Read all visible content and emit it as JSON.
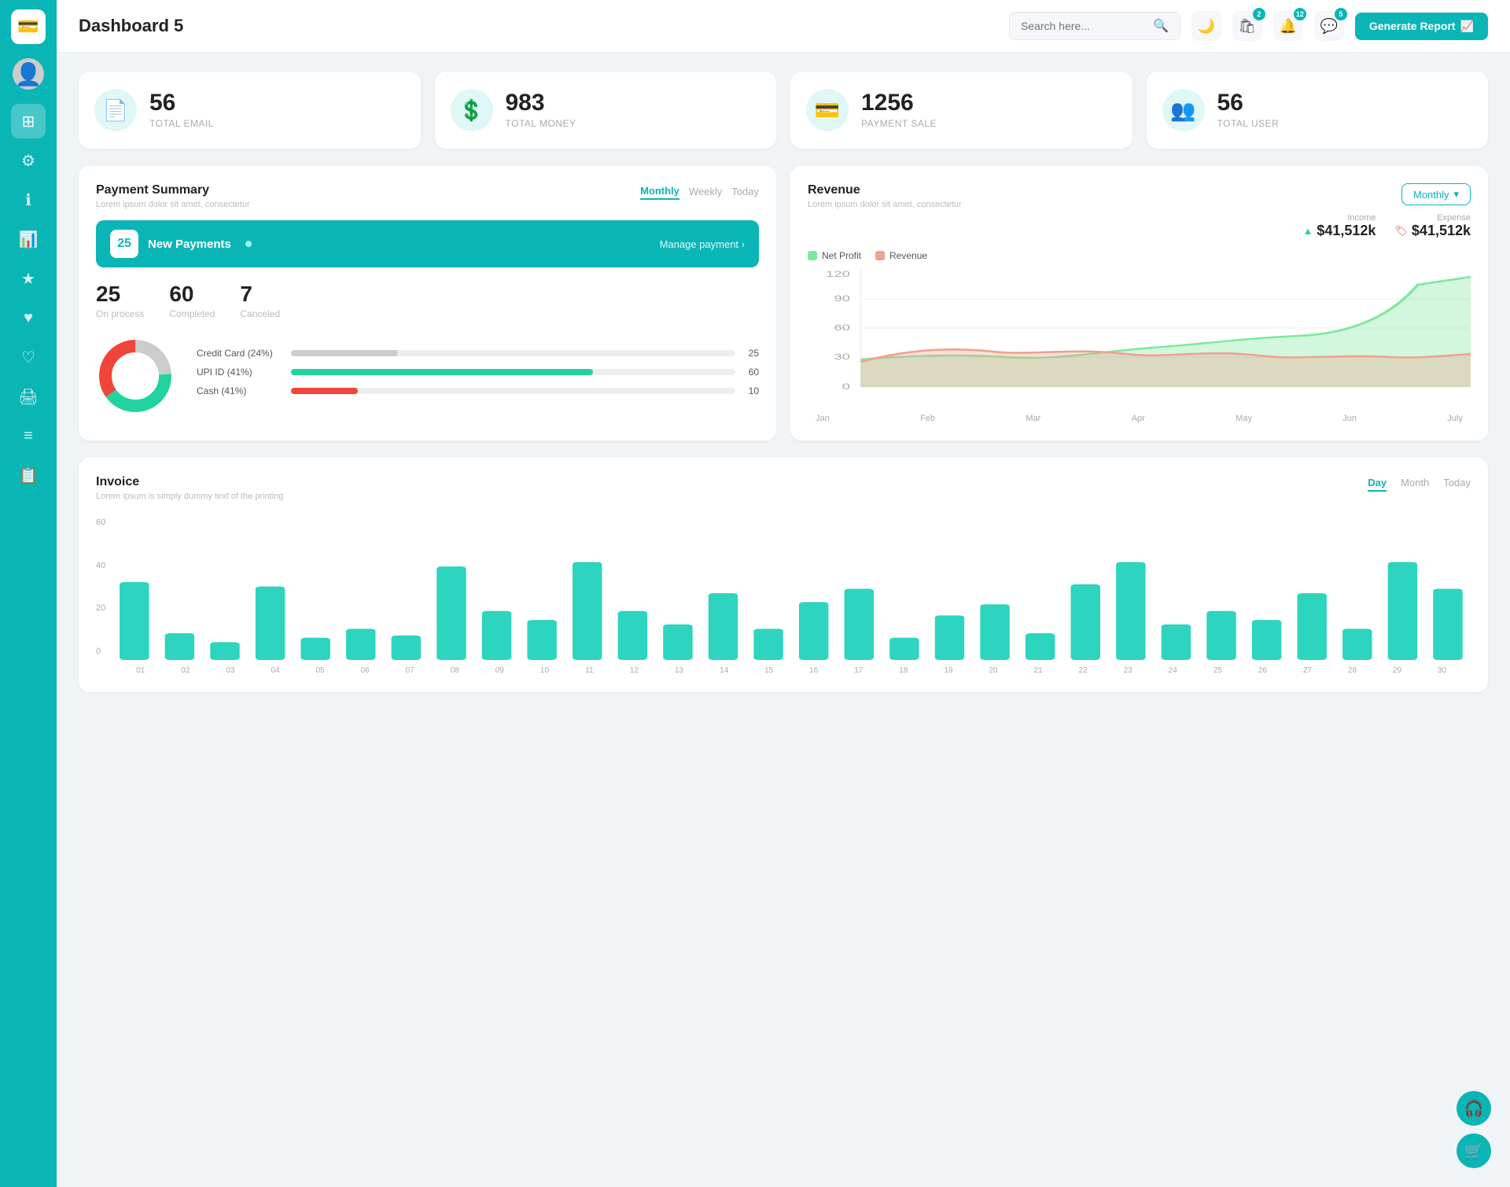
{
  "sidebar": {
    "logo_icon": "💳",
    "items": [
      {
        "id": "dashboard",
        "icon": "⊞",
        "active": true
      },
      {
        "id": "settings",
        "icon": "⚙"
      },
      {
        "id": "info",
        "icon": "ℹ"
      },
      {
        "id": "analytics",
        "icon": "📊"
      },
      {
        "id": "star",
        "icon": "★"
      },
      {
        "id": "heart1",
        "icon": "♥"
      },
      {
        "id": "heart2",
        "icon": "♡"
      },
      {
        "id": "print",
        "icon": "🖨"
      },
      {
        "id": "list",
        "icon": "≡"
      },
      {
        "id": "report",
        "icon": "📋"
      }
    ]
  },
  "header": {
    "title": "Dashboard 5",
    "search_placeholder": "Search here...",
    "generate_btn": "Generate Report",
    "icons": {
      "bag_badge": "2",
      "bell_badge": "12",
      "chat_badge": "5"
    }
  },
  "stat_cards": [
    {
      "id": "email",
      "icon": "📄",
      "value": "56",
      "label": "TOTAL EMAIL"
    },
    {
      "id": "money",
      "icon": "💲",
      "value": "983",
      "label": "TOTAL MONEY"
    },
    {
      "id": "payment",
      "icon": "💳",
      "value": "1256",
      "label": "PAYMENT SALE"
    },
    {
      "id": "user",
      "icon": "👥",
      "value": "56",
      "label": "TOTAL USER"
    }
  ],
  "payment_summary": {
    "title": "Payment Summary",
    "subtitle": "Lorem ipsum dolor sit amet, consectetur",
    "tabs": [
      "Monthly",
      "Weekly",
      "Today"
    ],
    "active_tab": "Monthly",
    "new_payments_count": "25",
    "new_payments_label": "New Payments",
    "manage_link": "Manage payment",
    "stats": [
      {
        "value": "25",
        "label": "On process"
      },
      {
        "value": "60",
        "label": "Completed"
      },
      {
        "value": "7",
        "label": "Canceled"
      }
    ],
    "methods": [
      {
        "label": "Credit Card (24%)",
        "percent": 24,
        "color": "#aaa",
        "count": "25"
      },
      {
        "label": "UPI ID (41%)",
        "percent": 41,
        "color": "#22d3a0",
        "count": "60"
      },
      {
        "label": "Cash (41%)",
        "percent": 10,
        "color": "#f0453a",
        "count": "10"
      }
    ],
    "donut": {
      "segments": [
        {
          "value": 24,
          "color": "#ddd"
        },
        {
          "value": 41,
          "color": "#22d3a0"
        },
        {
          "value": 35,
          "color": "#f0453a"
        }
      ]
    }
  },
  "revenue": {
    "title": "Revenue",
    "subtitle": "Lorem ipsum dolor sit amet, consectetur",
    "active_tab": "Monthly",
    "income_label": "Income",
    "income_value": "$41,512k",
    "expense_label": "Expense",
    "expense_value": "$41,512k",
    "legend": [
      {
        "label": "Net Profit",
        "color": "#7ee89a"
      },
      {
        "label": "Revenue",
        "color": "#f0a090"
      }
    ],
    "x_labels": [
      "Jan",
      "Feb",
      "Mar",
      "Apr",
      "May",
      "Jun",
      "July"
    ],
    "y_labels": [
      "0",
      "30",
      "60",
      "90",
      "120"
    ]
  },
  "invoice": {
    "title": "Invoice",
    "subtitle": "Lorem ipsum is simply dummy text of the printing",
    "tabs": [
      "Day",
      "Month",
      "Today"
    ],
    "active_tab": "Day",
    "y_labels": [
      "0",
      "20",
      "40",
      "60"
    ],
    "x_labels": [
      "01",
      "02",
      "03",
      "04",
      "05",
      "06",
      "07",
      "08",
      "09",
      "10",
      "11",
      "12",
      "13",
      "14",
      "15",
      "16",
      "17",
      "18",
      "19",
      "20",
      "21",
      "22",
      "23",
      "24",
      "25",
      "26",
      "27",
      "28",
      "29",
      "30"
    ],
    "bar_data": [
      35,
      12,
      8,
      33,
      10,
      14,
      11,
      42,
      22,
      18,
      44,
      22,
      16,
      30,
      14,
      26,
      32,
      10,
      20,
      25,
      12,
      34,
      44,
      16,
      22,
      18,
      30,
      14,
      44,
      32
    ]
  }
}
